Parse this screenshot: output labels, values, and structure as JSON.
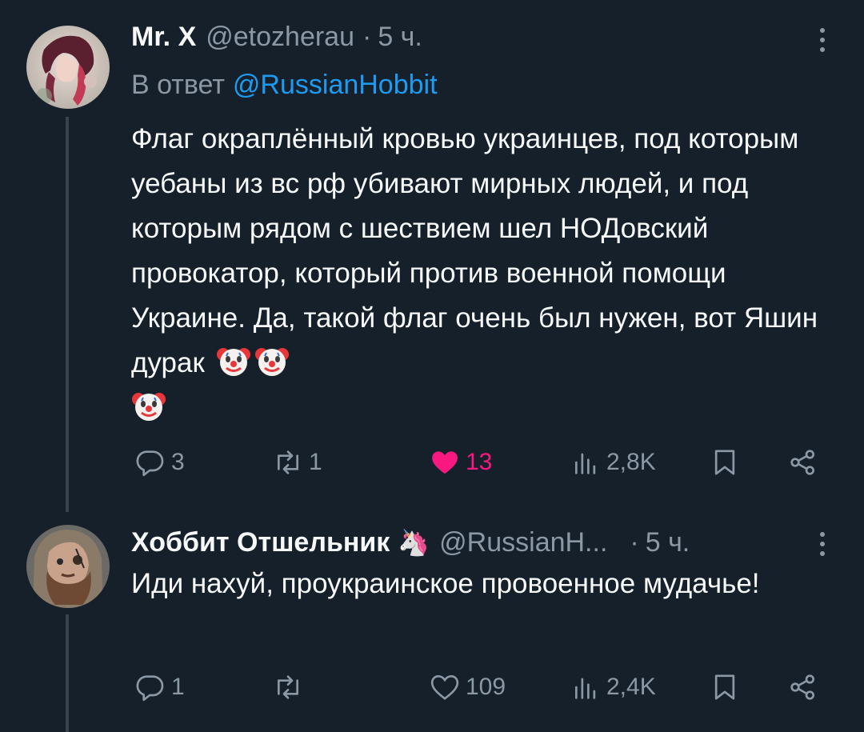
{
  "tweets": [
    {
      "display_name": "Mr. X",
      "handle": "@etozherau",
      "separator": "·",
      "time": "5 ч.",
      "reply_prefix": "В ответ",
      "reply_mention": "@RussianHobbit",
      "text": "Флаг окраплённый кровью украинцев, под которым уебаны из вс рф убивают мирных людей, и под которым рядом с шествием шел НОДовский провокатор, который против военной помощи Украине. Да, такой флаг очень был нужен, вот Яшин дурак",
      "emoji_trailing": [
        "clown-face",
        "clown-face",
        "clown-face"
      ],
      "replies": "3",
      "retweets": "1",
      "likes": "13",
      "views": "2,8K",
      "liked": true
    },
    {
      "display_name": "Хоббит Отшельник",
      "badge_emoji": "🦄",
      "handle": "@RussianH...",
      "separator": "·",
      "time": "5 ч.",
      "text": "Иди нахуй, проукраинское провоенное мудачье!",
      "replies": "1",
      "retweets": "",
      "likes": "109",
      "views": "2,4K",
      "liked": false
    }
  ],
  "colors": {
    "background": "#15202b",
    "text": "#f7f9f9",
    "muted": "#8b98a5",
    "link": "#1d9bf0",
    "like": "#f91880",
    "thread_line": "#38444d"
  },
  "icons": {
    "reply": "reply-icon",
    "retweet": "retweet-icon",
    "like": "heart-icon",
    "views": "views-icon",
    "bookmark": "bookmark-icon",
    "share": "share-icon",
    "more": "more-icon"
  }
}
